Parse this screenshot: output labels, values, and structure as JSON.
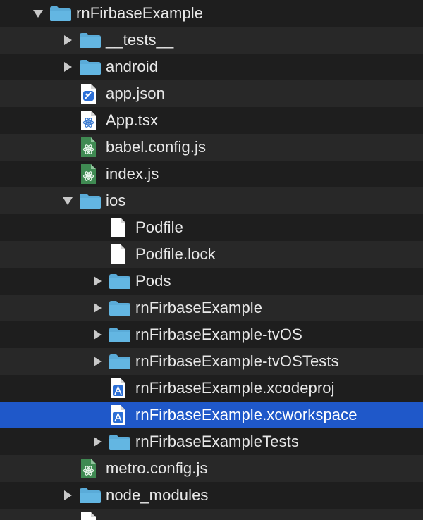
{
  "colors": {
    "background": "#1e1e1e",
    "row_alt": "#282828",
    "selection": "#1f58c9",
    "folder": "#5aabd8",
    "text": "#e8e8e8"
  },
  "tree": {
    "rows": [
      {
        "label": "rnFirbaseExample",
        "level": 0,
        "icon": "folder-icon",
        "expander": "expanded"
      },
      {
        "label": "__tests__",
        "level": 1,
        "icon": "folder-icon",
        "expander": "collapsed"
      },
      {
        "label": "android",
        "level": 1,
        "icon": "folder-icon",
        "expander": "collapsed"
      },
      {
        "label": "app.json",
        "level": 1,
        "icon": "json-file-icon",
        "expander": "none"
      },
      {
        "label": "App.tsx",
        "level": 1,
        "icon": "react-file-icon",
        "expander": "none"
      },
      {
        "label": "babel.config.js",
        "level": 1,
        "icon": "js-file-icon",
        "expander": "none"
      },
      {
        "label": "index.js",
        "level": 1,
        "icon": "js-file-icon",
        "expander": "none"
      },
      {
        "label": "ios",
        "level": 1,
        "icon": "folder-icon",
        "expander": "expanded"
      },
      {
        "label": "Podfile",
        "level": 2,
        "icon": "plain-file-icon",
        "expander": "none"
      },
      {
        "label": "Podfile.lock",
        "level": 2,
        "icon": "plain-file-icon",
        "expander": "none"
      },
      {
        "label": "Pods",
        "level": 2,
        "icon": "folder-icon",
        "expander": "collapsed"
      },
      {
        "label": "rnFirbaseExample",
        "level": 2,
        "icon": "folder-icon",
        "expander": "collapsed"
      },
      {
        "label": "rnFirbaseExample-tvOS",
        "level": 2,
        "icon": "folder-icon",
        "expander": "collapsed"
      },
      {
        "label": "rnFirbaseExample-tvOSTests",
        "level": 2,
        "icon": "folder-icon",
        "expander": "collapsed"
      },
      {
        "label": "rnFirbaseExample.xcodeproj",
        "level": 2,
        "icon": "xcodeproj-icon",
        "expander": "none"
      },
      {
        "label": "rnFirbaseExample.xcworkspace",
        "level": 2,
        "icon": "xcworkspace-icon",
        "expander": "none",
        "selected": true
      },
      {
        "label": "rnFirbaseExampleTests",
        "level": 2,
        "icon": "folder-icon",
        "expander": "collapsed"
      },
      {
        "label": "metro.config.js",
        "level": 1,
        "icon": "js-file-icon",
        "expander": "none"
      },
      {
        "label": "node_modules",
        "level": 1,
        "icon": "folder-icon",
        "expander": "collapsed"
      },
      {
        "label": "",
        "level": 1,
        "icon": "plain-file-icon",
        "expander": "none"
      }
    ]
  }
}
